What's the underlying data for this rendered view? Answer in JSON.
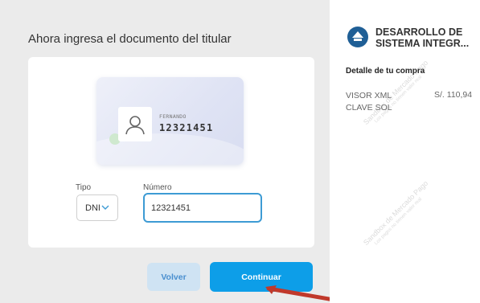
{
  "main": {
    "title": "Ahora ingresa el documento del titular",
    "id_card": {
      "name": "FERNANDO",
      "number": "12321451"
    },
    "form": {
      "tipo_label": "Tipo",
      "tipo_value": "DNI",
      "numero_label": "Número",
      "numero_value": "12321451"
    },
    "buttons": {
      "back": "Volver",
      "continue": "Continuar"
    }
  },
  "side": {
    "merchant_name_line1": "DESARROLLO DE",
    "merchant_name_line2": "SISTEMA INTEGR...",
    "detail_title": "Detalle de tu compra",
    "item_name": "VISOR XML CLAVE SOL",
    "item_price": "S/. 110,94",
    "watermark_main": "Sandbox de Mercado Pago",
    "watermark_sub": "Los pagos no tienen valor real"
  },
  "colors": {
    "primary": "#0d9ee8",
    "secondary_bg": "#cfe3f3",
    "input_focus": "#3d9bd4",
    "arrow": "#c0392b",
    "logo": "#1f5f96"
  }
}
